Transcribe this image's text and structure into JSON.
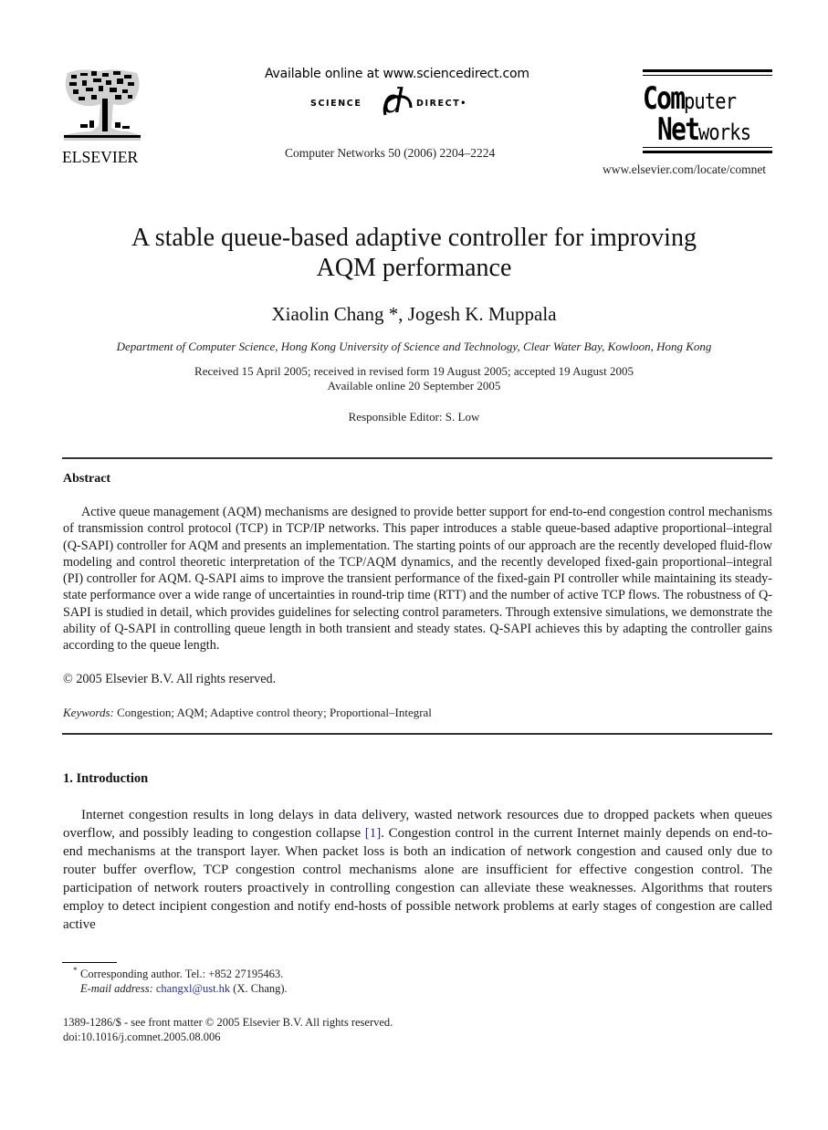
{
  "header": {
    "publisher_logo_text": "ELSEVIER",
    "available_online": "Available online at www.sciencedirect.com",
    "sciencedirect_left": "SCIENCE",
    "sciencedirect_at": "d",
    "sciencedirect_right": "DIRECT•",
    "journal_reference": "Computer Networks 50 (2006) 2204–2224",
    "journal_logo": {
      "line1_big": "Com",
      "line1_small": "puter",
      "line2_big": "Net",
      "line2_small": "works"
    },
    "journal_url": "www.elsevier.com/locate/comnet"
  },
  "article": {
    "title_line1": "A stable queue-based adaptive controller for improving",
    "title_line2": "AQM performance",
    "authors": "Xiaolin Chang *, Jogesh K. Muppala",
    "affiliation": "Department of Computer Science, Hong Kong University of Science and Technology, Clear Water Bay, Kowloon, Hong Kong",
    "received": "Received 15 April 2005; received in revised form 19 August 2005; accepted 19 August 2005",
    "available_online": "Available online 20 September 2005",
    "responsible_editor": "Responsible Editor: S. Low"
  },
  "abstract": {
    "heading": "Abstract",
    "text": "Active queue management (AQM) mechanisms are designed to provide better support for end-to-end congestion control mechanisms of transmission control protocol (TCP) in TCP/IP networks. This paper introduces a stable queue-based adaptive proportional–integral (Q-SAPI) controller for AQM and presents an implementation. The starting points of our approach are the recently developed fluid-flow modeling and control theoretic interpretation of the TCP/AQM dynamics, and the recently developed fixed-gain proportional–integral (PI) controller for AQM. Q-SAPI aims to improve the transient performance of the fixed-gain PI controller while maintaining its steady-state performance over a wide range of uncertainties in round-trip time (RTT) and the number of active TCP flows. The robustness of Q-SAPI is studied in detail, which provides guidelines for selecting control parameters. Through extensive simulations, we demonstrate the ability of Q-SAPI in controlling queue length in both transient and steady states. Q-SAPI achieves this by adapting the controller gains according to the queue length.",
    "copyright": "© 2005 Elsevier B.V. All rights reserved.",
    "keywords_label": "Keywords:",
    "keywords": "Congestion; AQM; Adaptive control theory; Proportional–Integral"
  },
  "introduction": {
    "heading": "1. Introduction",
    "text_before_ref": "Internet congestion results in long delays in data delivery, wasted network resources due to dropped packets when queues overflow, and possibly leading to congestion collapse ",
    "ref": "[1]",
    "text_after_ref": ". Congestion control in the current Internet mainly depends on end-to-end mechanisms at the transport layer. When packet loss is both an indication of network congestion and caused only due to router buffer overflow, TCP congestion control mechanisms alone are insufficient for effective congestion control. The participation of network routers proactively in controlling congestion can alleviate these weaknesses. Algorithms that routers employ to detect incipient congestion and notify end-hosts of possible network problems at early stages of congestion are called active"
  },
  "footnotes": {
    "star": "*",
    "corresponding": "Corresponding author. Tel.: +852 27195463.",
    "email_label": "E-mail address:",
    "email": "changxl@ust.hk",
    "email_suffix": " (X. Chang).",
    "front_matter": "1389-1286/$ - see front matter  © 2005 Elsevier B.V. All rights reserved.",
    "doi": "doi:10.1016/j.comnet.2005.08.006"
  }
}
